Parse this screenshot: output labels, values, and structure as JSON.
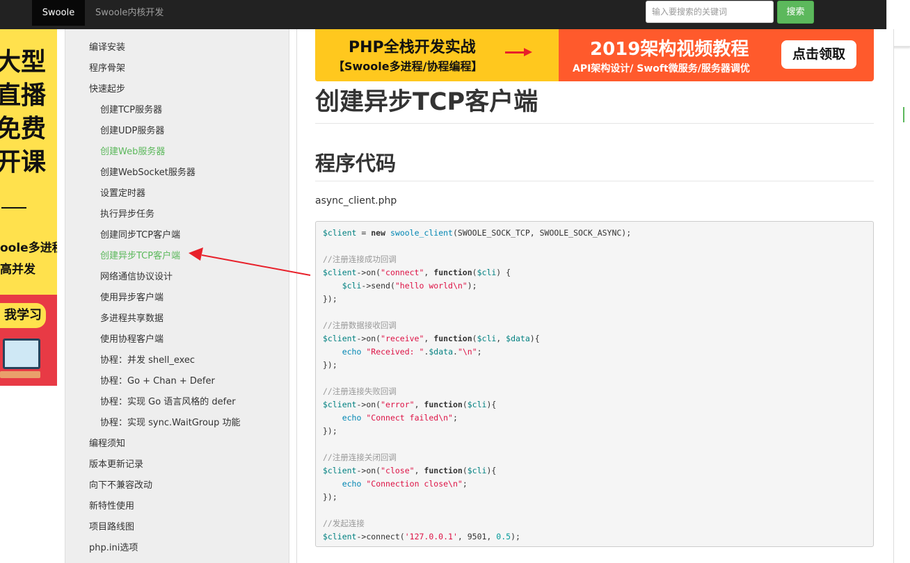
{
  "topnav": {
    "brand": "Swoole",
    "link": "Swoole内核开发",
    "search_placeholder": "输入要搜索的关键词",
    "search_button": "搜索"
  },
  "ad": {
    "lines_big": [
      "大型",
      "直播",
      "免费",
      "开课"
    ],
    "lines_small": [
      "oole多进程",
      "高并发"
    ],
    "button": "我学习"
  },
  "sidebar": {
    "items": [
      {
        "label": "编译安装",
        "level": 1,
        "active": false
      },
      {
        "label": "程序骨架",
        "level": 1,
        "active": false
      },
      {
        "label": "快速起步",
        "level": 1,
        "active": false
      },
      {
        "label": "创建TCP服务器",
        "level": 2,
        "active": false
      },
      {
        "label": "创建UDP服务器",
        "level": 2,
        "active": false
      },
      {
        "label": "创建Web服务器",
        "level": 2,
        "active": true
      },
      {
        "label": "创建WebSocket服务器",
        "level": 2,
        "active": false
      },
      {
        "label": "设置定时器",
        "level": 2,
        "active": false
      },
      {
        "label": "执行异步任务",
        "level": 2,
        "active": false
      },
      {
        "label": "创建同步TCP客户端",
        "level": 2,
        "active": false
      },
      {
        "label": "创建异步TCP客户端",
        "level": 2,
        "active": true
      },
      {
        "label": "网络通信协议设计",
        "level": 2,
        "active": false
      },
      {
        "label": "使用异步客户端",
        "level": 2,
        "active": false
      },
      {
        "label": "多进程共享数据",
        "level": 2,
        "active": false
      },
      {
        "label": "使用协程客户端",
        "level": 2,
        "active": false
      },
      {
        "label": "协程：并发 shell_exec",
        "level": 2,
        "active": false
      },
      {
        "label": "协程：Go + Chan + Defer",
        "level": 2,
        "active": false
      },
      {
        "label": "协程：实现 Go 语言风格的 defer",
        "level": 2,
        "active": false
      },
      {
        "label": "协程：实现 sync.WaitGroup 功能",
        "level": 2,
        "active": false
      },
      {
        "label": "编程须知",
        "level": 1,
        "active": false
      },
      {
        "label": "版本更新记录",
        "level": 1,
        "active": false
      },
      {
        "label": "向下不兼容改动",
        "level": 1,
        "active": false
      },
      {
        "label": "新特性使用",
        "level": 1,
        "active": false
      },
      {
        "label": "项目路线图",
        "level": 1,
        "active": false
      },
      {
        "label": "php.ini选项",
        "level": 1,
        "active": false
      }
    ]
  },
  "banner": {
    "title": "PHP全栈开发实战",
    "subtitle": "【Swoole多进程/协程编程】",
    "headline": "2019架构视频教程",
    "tagline": "API架构设计/ Swoft微服务/服务器调优",
    "cta": "点击领取"
  },
  "article": {
    "title": "创建异步TCP客户端",
    "section": "程序代码",
    "filename": "async_client.php"
  },
  "code": {
    "lines": [
      [
        [
          "v",
          "$client"
        ],
        [
          "p",
          " = "
        ],
        [
          "k",
          "new"
        ],
        [
          "p",
          " "
        ],
        [
          "f",
          "swoole_client"
        ],
        [
          "p",
          "(SWOOLE_SOCK_TCP, SWOOLE_SOCK_ASYNC);"
        ]
      ],
      [],
      [
        [
          "c",
          "//注册连接成功回调"
        ]
      ],
      [
        [
          "v",
          "$client"
        ],
        [
          "p",
          "->on("
        ],
        [
          "s",
          "\"connect\""
        ],
        [
          "p",
          ", "
        ],
        [
          "k",
          "function"
        ],
        [
          "p",
          "("
        ],
        [
          "v",
          "$cli"
        ],
        [
          "p",
          ") {"
        ]
      ],
      [
        [
          "p",
          "    "
        ],
        [
          "v",
          "$cli"
        ],
        [
          "p",
          "->send("
        ],
        [
          "s",
          "\"hello world\\n\""
        ],
        [
          "p",
          ");"
        ]
      ],
      [
        [
          "p",
          "});"
        ]
      ],
      [],
      [
        [
          "c",
          "//注册数据接收回调"
        ]
      ],
      [
        [
          "v",
          "$client"
        ],
        [
          "p",
          "->on("
        ],
        [
          "s",
          "\"receive\""
        ],
        [
          "p",
          ", "
        ],
        [
          "k",
          "function"
        ],
        [
          "p",
          "("
        ],
        [
          "v",
          "$cli"
        ],
        [
          "p",
          ", "
        ],
        [
          "v",
          "$data"
        ],
        [
          "p",
          "){"
        ]
      ],
      [
        [
          "p",
          "    "
        ],
        [
          "f",
          "echo"
        ],
        [
          "p",
          " "
        ],
        [
          "s",
          "\"Received: \""
        ],
        [
          "p",
          "."
        ],
        [
          "v",
          "$data"
        ],
        [
          "p",
          "."
        ],
        [
          "s",
          "\"\\n\""
        ],
        [
          "p",
          ";"
        ]
      ],
      [
        [
          "p",
          "});"
        ]
      ],
      [],
      [
        [
          "c",
          "//注册连接失败回调"
        ]
      ],
      [
        [
          "v",
          "$client"
        ],
        [
          "p",
          "->on("
        ],
        [
          "s",
          "\"error\""
        ],
        [
          "p",
          ", "
        ],
        [
          "k",
          "function"
        ],
        [
          "p",
          "("
        ],
        [
          "v",
          "$cli"
        ],
        [
          "p",
          "){"
        ]
      ],
      [
        [
          "p",
          "    "
        ],
        [
          "f",
          "echo"
        ],
        [
          "p",
          " "
        ],
        [
          "s",
          "\"Connect failed\\n\""
        ],
        [
          "p",
          ";"
        ]
      ],
      [
        [
          "p",
          "});"
        ]
      ],
      [],
      [
        [
          "c",
          "//注册连接关闭回调"
        ]
      ],
      [
        [
          "v",
          "$client"
        ],
        [
          "p",
          "->on("
        ],
        [
          "s",
          "\"close\""
        ],
        [
          "p",
          ", "
        ],
        [
          "k",
          "function"
        ],
        [
          "p",
          "("
        ],
        [
          "v",
          "$cli"
        ],
        [
          "p",
          "){"
        ]
      ],
      [
        [
          "p",
          "    "
        ],
        [
          "f",
          "echo"
        ],
        [
          "p",
          " "
        ],
        [
          "s",
          "\"Connection close\\n\""
        ],
        [
          "p",
          ";"
        ]
      ],
      [
        [
          "p",
          "});"
        ]
      ],
      [],
      [
        [
          "c",
          "//发起连接"
        ]
      ],
      [
        [
          "v",
          "$client"
        ],
        [
          "p",
          "->connect("
        ],
        [
          "s",
          "'127.0.0.1'"
        ],
        [
          "p",
          ", 9501, "
        ],
        [
          "n",
          "0.5"
        ],
        [
          "p",
          ");"
        ]
      ]
    ]
  },
  "colors": {
    "topbar": "#222222",
    "accent_green": "#5cb85c",
    "annotation_arrow": "#e8202a",
    "banner_yellow": "#ffc81e",
    "banner_orange": "#ff5a2c"
  }
}
